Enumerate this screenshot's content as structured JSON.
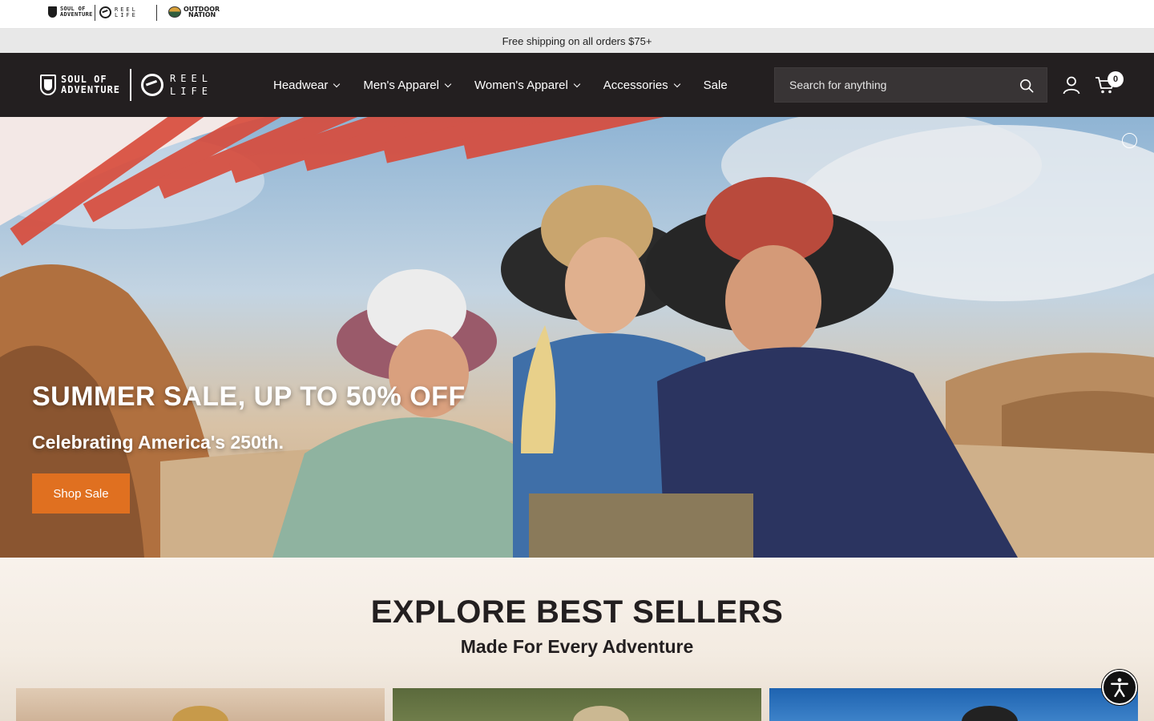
{
  "brand_strip": {
    "soul_of_adventure": "SOUL OF ADVENTURE",
    "soul_of_adventure_line1": "SOUL OF",
    "soul_of_adventure_line2": "ADVENTURE",
    "reel_life": "REEL LIFE",
    "reel_life_line1": "REEL",
    "reel_life_line2": "LIFE",
    "outdoor_nation": "OUTDOOR NATION",
    "outdoor_nation_line1": "OUTDOOR",
    "outdoor_nation_line2": "NATION"
  },
  "announcement": "Free shipping on all orders $75+",
  "header": {
    "logo_soa_line1": "SOUL OF",
    "logo_soa_line2": "ADVENTURE",
    "logo_reel_line1": "REEL",
    "logo_reel_line2": "LIFE",
    "nav": [
      {
        "label": "Headwear",
        "has_dropdown": true
      },
      {
        "label": "Men's Apparel",
        "has_dropdown": true
      },
      {
        "label": "Women's Apparel",
        "has_dropdown": true
      },
      {
        "label": "Accessories",
        "has_dropdown": true
      },
      {
        "label": "Sale",
        "has_dropdown": false
      }
    ],
    "search_placeholder": "Search for anything",
    "cart_count": "0"
  },
  "hero": {
    "title": "SUMMER SALE, UP TO 50% OFF",
    "subtitle": "Celebrating America's 250th.",
    "button": "Shop Sale"
  },
  "best_sellers": {
    "title": "EXPLORE BEST SELLERS",
    "subtitle": "Made For Every Adventure"
  },
  "colors": {
    "header_bg": "#231f20",
    "accent": "#e07020",
    "announce_bg": "#e8e8e8"
  },
  "icons": [
    "search-icon",
    "account-icon",
    "cart-icon",
    "chevron-down-icon",
    "accessibility-icon"
  ]
}
